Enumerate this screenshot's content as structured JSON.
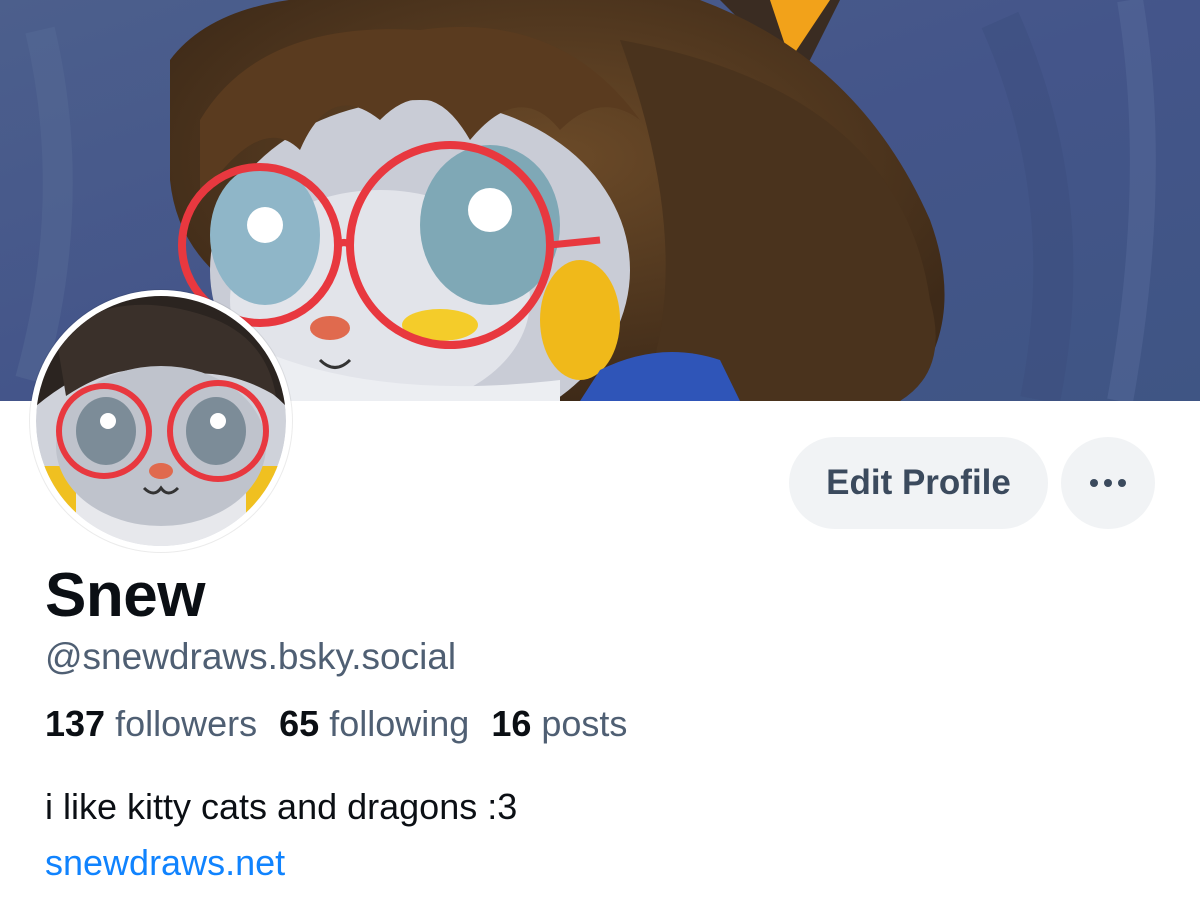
{
  "profile": {
    "display_name": "Snew",
    "handle": "@snewdraws.bsky.social",
    "bio": "i like kitty cats and dragons :3",
    "website": "snewdraws.net"
  },
  "stats": {
    "followers_count": "137",
    "followers_label": "followers",
    "following_count": "65",
    "following_label": "following",
    "posts_count": "16",
    "posts_label": "posts"
  },
  "actions": {
    "edit_profile_label": "Edit Profile",
    "more_icon": "ellipsis-icon"
  },
  "colors": {
    "link": "#1083fe",
    "button_bg": "#f1f3f5",
    "muted_text": "#4f5f73",
    "glasses": "#e8383f"
  }
}
